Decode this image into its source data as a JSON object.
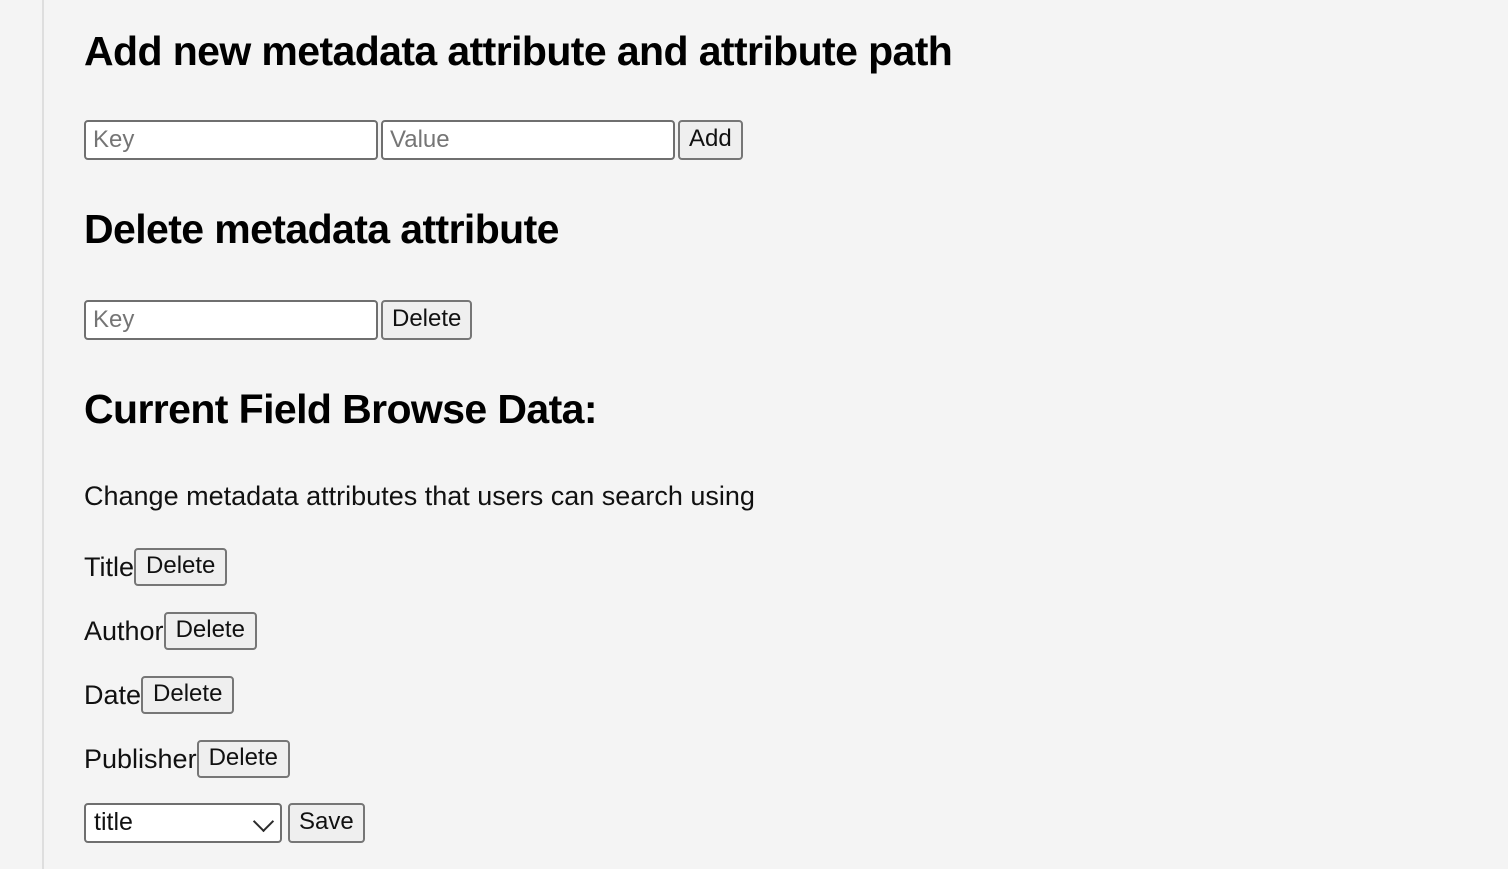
{
  "sections": {
    "add": {
      "heading": "Add new metadata attribute and attribute path",
      "key_placeholder": "Key",
      "key_value": "",
      "value_placeholder": "Value",
      "value_value": "",
      "add_label": "Add"
    },
    "delete": {
      "heading": "Delete metadata attribute",
      "key_placeholder": "Key",
      "key_value": "",
      "delete_label": "Delete"
    },
    "current": {
      "heading": "Current Field Browse Data:",
      "description": "Change metadata attributes that users can search using",
      "fields": [
        {
          "label": "Title",
          "delete_label": "Delete"
        },
        {
          "label": "Author",
          "delete_label": "Delete"
        },
        {
          "label": "Date",
          "delete_label": "Delete"
        },
        {
          "label": "Publisher",
          "delete_label": "Delete"
        }
      ],
      "select": {
        "selected": "title",
        "options": [
          "title"
        ],
        "icon": "chevron-down-icon"
      },
      "save_label": "Save"
    }
  },
  "colors": {
    "page_background": "#f4f4f4",
    "divider": "#dedede",
    "text": "#111111",
    "placeholder": "#757575",
    "control_border": "#6f6f6f",
    "button_background": "#efefef",
    "button_border": "#767676",
    "input_background": "#ffffff"
  }
}
